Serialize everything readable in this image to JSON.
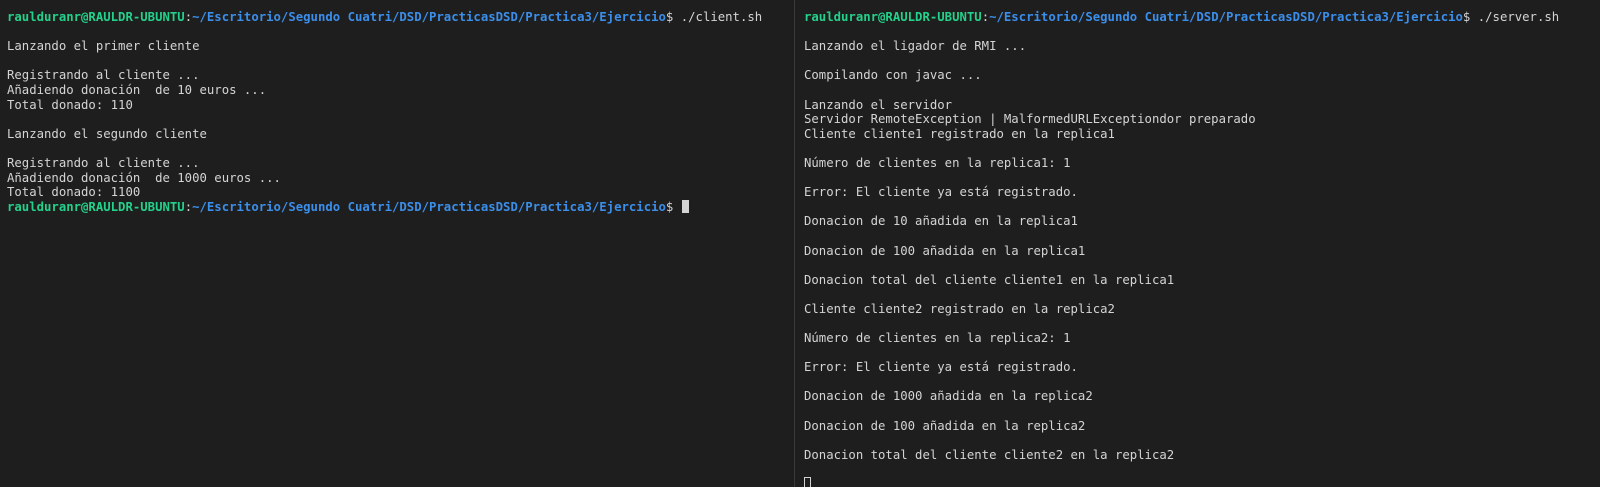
{
  "left_terminal": {
    "prompt_user": "raulduranr@RAULDR-UBUNTU",
    "prompt_colon": ":",
    "prompt_path": "~/Escritorio/Segundo Cuatri/DSD/PracticasDSD/Practica3/Ejercicio",
    "prompt_symbol": "$ ",
    "command": "./client.sh",
    "output": [
      "",
      "Lanzando el primer cliente",
      "",
      "Registrando al cliente ...",
      "Añadiendo donación  de 10 euros ...",
      "Total donado: 110",
      "",
      "Lanzando el segundo cliente",
      "",
      "Registrando al cliente ...",
      "Añadiendo donación  de 1000 euros ...",
      "Total donado: 1100"
    ],
    "final_prompt_user": "raulduranr@RAULDR-UBUNTU",
    "final_prompt_path": "~/Escritorio/Segundo Cuatri/DSD/PracticasDSD/Practica3/Ejercicio",
    "final_prompt_symbol": "$ "
  },
  "right_terminal": {
    "prompt_user": "raulduranr@RAULDR-UBUNTU",
    "prompt_colon": ":",
    "prompt_path": "~/Escritorio/Segundo Cuatri/DSD/PracticasDSD/Practica3/Ejercicio",
    "prompt_symbol": "$ ",
    "command": "./server.sh",
    "output": [
      "",
      "Lanzando el ligador de RMI ...",
      "",
      "Compilando con javac ...",
      "",
      "Lanzando el servidor",
      "Servidor RemoteException | MalformedURLExceptiondor preparado",
      "Cliente cliente1 registrado en la replica1",
      "",
      "Número de clientes en la replica1: 1",
      "",
      "Error: El cliente ya está registrado.",
      "",
      "Donacion de 10 añadida en la replica1",
      "",
      "Donacion de 100 añadida en la replica1",
      "",
      "Donacion total del cliente cliente1 en la replica1",
      "",
      "Cliente cliente2 registrado en la replica2",
      "",
      "Número de clientes en la replica2: 1",
      "",
      "Error: El cliente ya está registrado.",
      "",
      "Donacion de 1000 añadida en la replica2",
      "",
      "Donacion de 100 añadida en la replica2",
      "",
      "Donacion total del cliente cliente2 en la replica2",
      ""
    ]
  },
  "colors": {
    "background": "#1e1e1e",
    "text": "#d4d4d4",
    "prompt_user": "#23d18b",
    "prompt_path": "#3b8eea"
  }
}
